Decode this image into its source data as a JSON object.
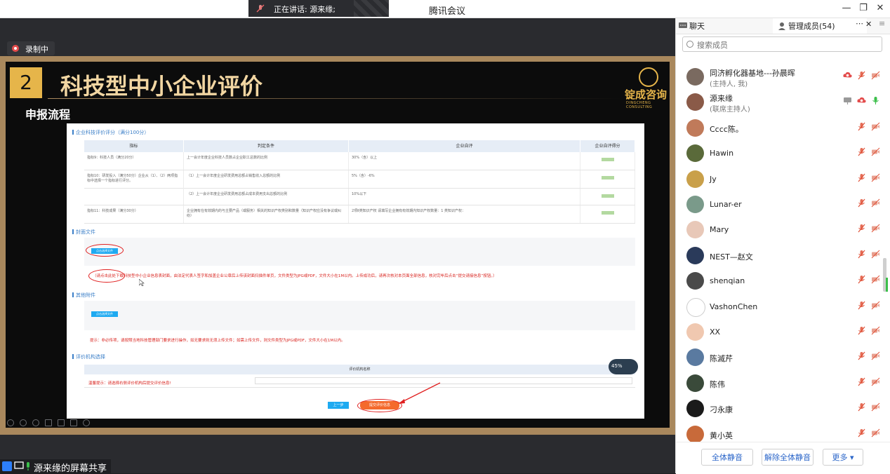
{
  "app": {
    "title": "腾讯会议"
  },
  "speaking": {
    "text": "正在讲话: 源来缘;"
  },
  "recording": {
    "label": "录制中"
  },
  "slide": {
    "number": "2",
    "title": "科技型中小企业评价",
    "subtitle": "申报流程",
    "logo_cn": "锭成咨询",
    "logo_en": "DINGCHENG CONSULTING"
  },
  "form": {
    "section1": "企业科技评价评分（满分100分）",
    "headers": [
      "指标",
      "判定条件",
      "企业自评",
      "企业自评得分"
    ],
    "rows": [
      {
        "indicator": "指标9：科技人员（满分20分）",
        "condition": "上一会计年度企业科技人员数占企业职工总数的比例",
        "self": "30%（含）以上"
      },
      {
        "indicator": "指标10：研发投入（满分50分）企业从（1）、（2）两项指标中选择一个指标进行评分。",
        "condition": "（1）上一会计年度企业研发费用总额占销售收入总额的比例",
        "self": "5%（含）-6%"
      },
      {
        "indicator": "",
        "condition": "（2）上一会计年度企业研发费用总额占成本费用支出总额的比例",
        "self": "10%以下"
      },
      {
        "indicator": "指标11：科技成果（满分30分）",
        "condition": "企业拥有在有效期内的与主要产品（或服务）相关的知识产权类别和数量（知识产权应没有争议或纠纷）",
        "self": "2项Ⅱ类知识产权 请填写企业拥有有效期内知识产权数量：1 类知识产权："
      }
    ],
    "section2": "封面文件",
    "upload_label": "点击选择文件",
    "cover_note": "（请点击此处下载科技型中小企业信息表封面，由法定代表人签字和加盖企业公章后上传该封面扫描件单页，文件类型为JPG或PDF，文件大小在1M以内。上传成功后，请再次核对本页面全部信息，核对完毕后点击“提交请接信息”按钮。）",
    "section3": "其他附件",
    "attach_note": "提示：非必传项，请按照当地科技管理部门要求进行操作，如无要求则无须上传文件；如需上传文件，则文件类型为JPG或PDF，文件大小在1M以内。",
    "section4": "评价机构选择",
    "org_header": "评价机构名称",
    "org_note": "温馨提示：请选择右侧评价机构后提交评价信息!",
    "prev_btn": "上一步",
    "submit_btn": "提交评价信息",
    "badge": "45%"
  },
  "share": {
    "label": "源来缘的屏幕共享"
  },
  "panel": {
    "tab_chat": "聊天",
    "tab_members": "管理成员(54)",
    "search_placeholder": "搜索成员",
    "members": [
      {
        "name": "同济孵化器基地---孙晨晖",
        "role": "(主持人, 我)",
        "color": "#7a6a60"
      },
      {
        "name": "源来缘",
        "role": "(联席主持人)",
        "color": "#8a5a48"
      },
      {
        "name": "Cccc陈。",
        "role": "",
        "color": "#c07a5a"
      },
      {
        "name": "Hawin",
        "role": "",
        "color": "#5a6a3a"
      },
      {
        "name": "Jy",
        "role": "",
        "color": "#c9a04a"
      },
      {
        "name": "Lunar-er",
        "role": "",
        "color": "#7a9a8a"
      },
      {
        "name": "Mary",
        "role": "",
        "color": "#e8c8b8"
      },
      {
        "name": "NEST—赵文",
        "role": "",
        "color": "#2a3a5a"
      },
      {
        "name": "shenqian",
        "role": "",
        "color": "#4a4a4a"
      },
      {
        "name": "VashonChen",
        "role": "",
        "color": "#ffffff"
      },
      {
        "name": "XX",
        "role": "",
        "color": "#f0c8b0"
      },
      {
        "name": "陈滅芹",
        "role": "",
        "color": "#5a7aa0"
      },
      {
        "name": "陈伟",
        "role": "",
        "color": "#3a4a3a"
      },
      {
        "name": "刁永康",
        "role": "",
        "color": "#1a1a1a"
      },
      {
        "name": "黄小英",
        "role": "",
        "color": "#c86a3a"
      }
    ],
    "mute_all": "全体静音",
    "unmute_all": "解除全体静音",
    "more": "更多 ▾"
  },
  "colors": {
    "accent": "#2b66c9",
    "slide_gold": "#e6b54a",
    "mute_red": "#e0533a"
  }
}
